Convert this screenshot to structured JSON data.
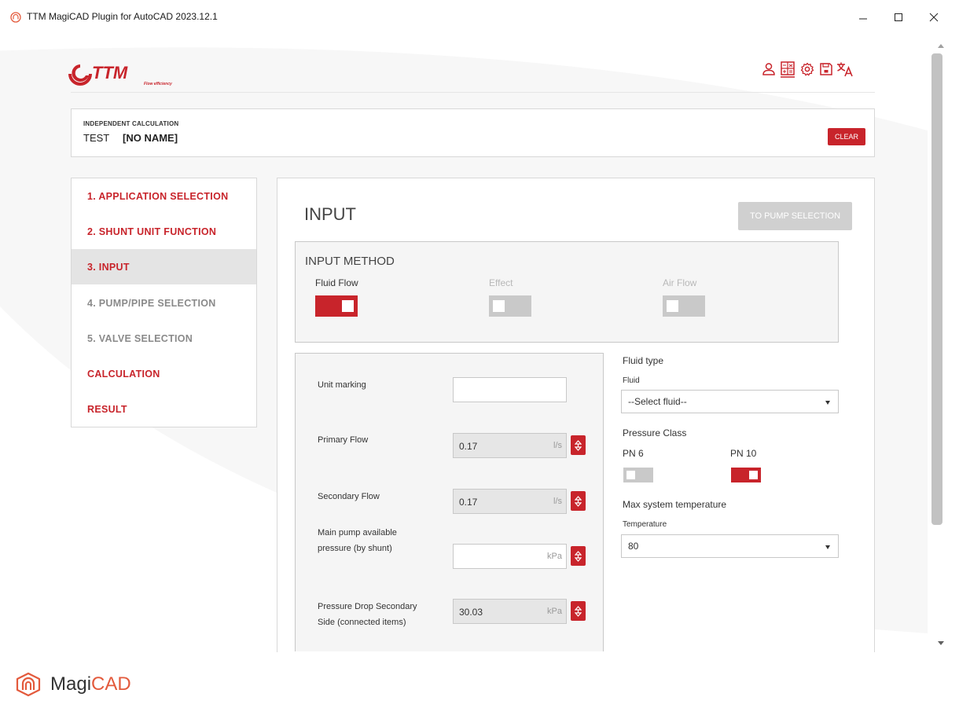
{
  "window": {
    "title": "TTM MagiCAD Plugin for AutoCAD 2023.12.1"
  },
  "header": {
    "logo_text": "TTM",
    "logo_tagline": "Flow efficiency",
    "icons": [
      "user-icon",
      "calculator-icon",
      "gear-icon",
      "save-icon",
      "translate-icon"
    ]
  },
  "project": {
    "calc_type": "INDEPENDENT CALCULATION",
    "name": "TEST",
    "subname": "[NO NAME]",
    "clear_label": "CLEAR"
  },
  "nav": {
    "items": [
      {
        "label": "1. APPLICATION SELECTION",
        "state": "done"
      },
      {
        "label": "2. SHUNT UNIT FUNCTION",
        "state": "done"
      },
      {
        "label": "3. INPUT",
        "state": "active"
      },
      {
        "label": "4. PUMP/PIPE SELECTION",
        "state": "disabled"
      },
      {
        "label": "5. VALVE SELECTION",
        "state": "disabled"
      },
      {
        "label": "CALCULATION",
        "state": "done"
      },
      {
        "label": "RESULT",
        "state": "done"
      }
    ]
  },
  "main": {
    "title": "INPUT",
    "next_label": "TO PUMP SELECTION",
    "method": {
      "title": "INPUT METHOD",
      "options": [
        {
          "label": "Fluid Flow",
          "on": true
        },
        {
          "label": "Effect",
          "on": false
        },
        {
          "label": "Air Flow",
          "on": false
        }
      ]
    },
    "fields": {
      "unit_marking": {
        "label": "Unit marking",
        "value": ""
      },
      "primary_flow": {
        "label": "Primary Flow",
        "value": "0.17",
        "unit": "l/s"
      },
      "secondary_flow": {
        "label": "Secondary Flow",
        "value": "0.17",
        "unit": "l/s"
      },
      "main_pump": {
        "label_1": "Main pump available",
        "label_2": "pressure (by shunt)",
        "value": "",
        "unit": "kPa"
      },
      "pressure_drop": {
        "label_1": "Pressure Drop Secondary",
        "label_2": "Side (connected items)",
        "value": "30.03",
        "unit": "kPa"
      }
    },
    "fluid": {
      "title": "Fluid type",
      "sub": "Fluid",
      "selected": "--Select fluid--"
    },
    "pressure": {
      "title": "Pressure Class",
      "pn6": {
        "label": "PN 6",
        "on": false
      },
      "pn10": {
        "label": "PN 10",
        "on": true
      }
    },
    "temperature": {
      "title": "Max system temperature",
      "sub": "Temperature",
      "selected": "80"
    }
  },
  "footer": {
    "brand_1": "Magi",
    "brand_2": "CAD"
  },
  "colors": {
    "accent": "#c8242b",
    "disabled": "#c9c9c9",
    "magicad_orange": "#e35a3c"
  }
}
